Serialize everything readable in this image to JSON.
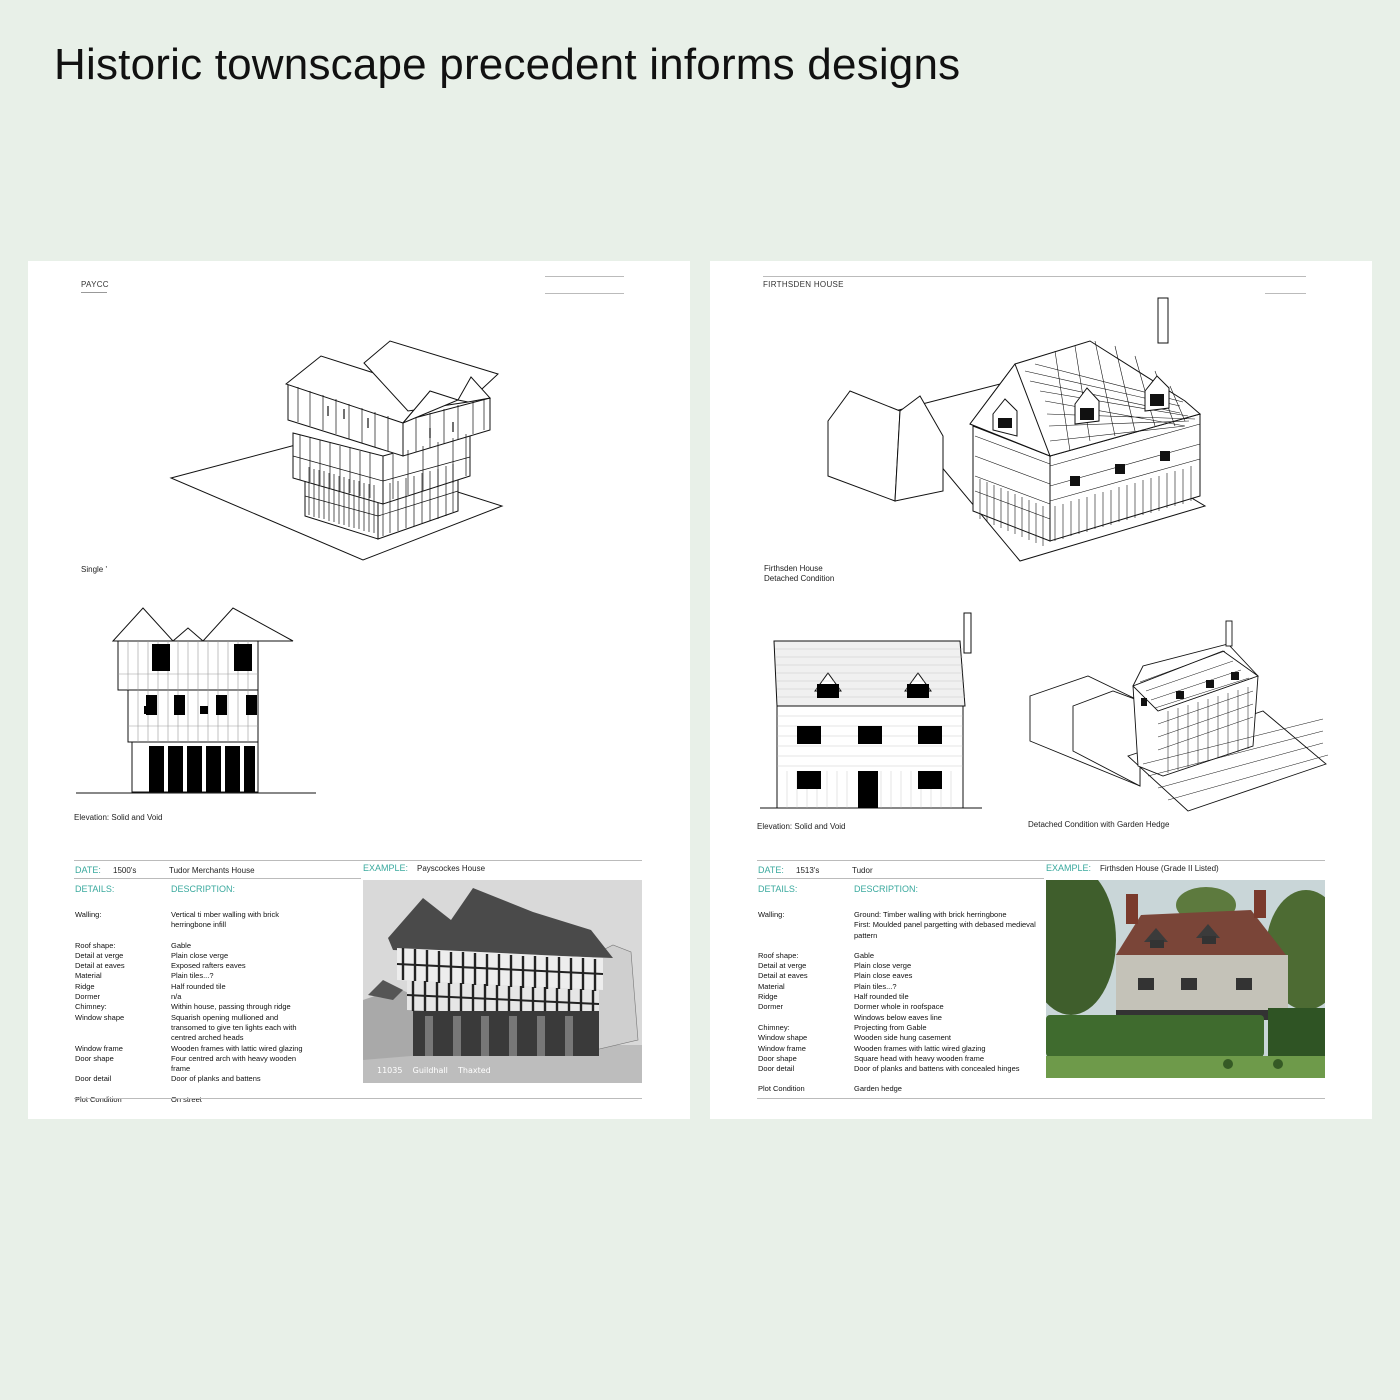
{
  "page": {
    "title": "Historic townscape precedent informs designs"
  },
  "left": {
    "header": "PAYCC",
    "caption_axo": "Single '",
    "caption_elev": "Elevation: Solid and Void",
    "date_label": "DATE:",
    "date_value": "1500's",
    "date_desc": "Tudor Merchants House",
    "example_label": "EXAMPLE:",
    "example_value": "Payscockes House",
    "details_label": "DETAILS:",
    "description_label": "DESCRIPTION:",
    "specs": [
      {
        "k": "Walling:",
        "v": "Vertical ti mber walling with brick herringbone infill"
      },
      {
        "k": "Roof shape:",
        "v": "Gable"
      },
      {
        "k": "Detail at verge",
        "v": "Plain close verge"
      },
      {
        "k": "Detail at eaves",
        "v": "Exposed rafters eaves"
      },
      {
        "k": "Material",
        "v": "Plain tiles...?"
      },
      {
        "k": "Ridge",
        "v": "Half rounded tile"
      },
      {
        "k": "Dormer",
        "v": "n/a"
      },
      {
        "k": "Chimney:",
        "v": "Within house, passing through ridge"
      },
      {
        "k": "Window shape",
        "v": "Squarish opening mullioned and transomed to give ten lights each with centred arched heads"
      },
      {
        "k": "Window frame",
        "v": "Wooden frames with lattic wired glazing"
      },
      {
        "k": "Door shape",
        "v": "Four centred arch with heavy wooden frame"
      },
      {
        "k": "Door detail",
        "v": "Door of planks and battens"
      }
    ],
    "plot_label": "Plot Condition",
    "plot_value": "On street",
    "photo_caption": "11035    Guildhall    Thaxted"
  },
  "right": {
    "header": "FIRTHSDEN HOUSE",
    "caption_axo": "Firthsden House\nDetached Condition",
    "caption_elev": "Elevation: Solid and Void",
    "caption_hedge": "Detached Condition with Garden Hedge",
    "date_label": "DATE:",
    "date_value": "1513's",
    "date_desc": "Tudor",
    "example_label": "EXAMPLE:",
    "example_value": "Firthsden House (Grade II Listed)",
    "details_label": "DETAILS:",
    "description_label": "DESCRIPTION:",
    "specs": [
      {
        "k": "Walling:",
        "v": "Ground: Timber walling with brick herringbone\nFirst:  Moulded panel pargetting with debased medieval pattern"
      },
      {
        "k": "Roof shape:",
        "v": "Gable"
      },
      {
        "k": "Detail at verge",
        "v": "Plain close verge"
      },
      {
        "k": "Detail at eaves",
        "v": "Plain close eaves"
      },
      {
        "k": "Material",
        "v": "Plain tiles...?"
      },
      {
        "k": "Ridge",
        "v": "Half rounded tile"
      },
      {
        "k": "Dormer",
        "v": "Dormer whole in roofspace\nWindows below eaves line"
      },
      {
        "k": "Chimney:",
        "v": "Projecting from Gable"
      },
      {
        "k": "Window shape",
        "v": "Wooden side hung casement"
      },
      {
        "k": "Window frame",
        "v": "Wooden frames with lattic wired glazing"
      },
      {
        "k": "Door shape",
        "v": "Square head with heavy wooden frame"
      },
      {
        "k": "Door detail",
        "v": "Door of planks and battens with concealed hinges"
      }
    ],
    "plot_label": "Plot Condition",
    "plot_value": "Garden hedge"
  }
}
